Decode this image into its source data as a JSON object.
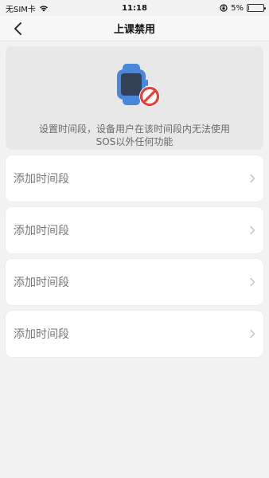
{
  "status_bar": {
    "carrier": "无SIM卡",
    "time": "11:18",
    "battery_percent": "5%",
    "battery_level": 0.05
  },
  "nav": {
    "title": "上课禁用"
  },
  "hero": {
    "icon": "watch-prohibited-icon",
    "description_line1": "设置时间段，设备用户在该时间段内无法使用",
    "description_line2": "SOS以外任何功能"
  },
  "time_slots": [
    {
      "label": "添加时间段"
    },
    {
      "label": "添加时间段"
    },
    {
      "label": "添加时间段"
    },
    {
      "label": "添加时间段"
    }
  ],
  "colors": {
    "background": "#f2f2f2",
    "hero_background": "#e8e8e8",
    "watch_blue": "#4a86d9",
    "prohibit_red": "#e0433a"
  }
}
